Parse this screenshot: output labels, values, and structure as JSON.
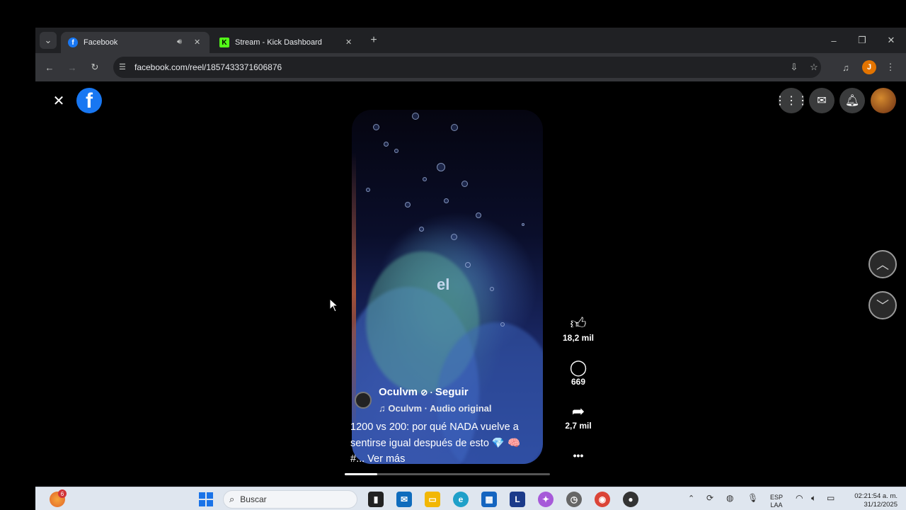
{
  "browser": {
    "tabs": [
      {
        "title": "Facebook",
        "favicon": "f"
      },
      {
        "title": "Stream - Kick Dashboard",
        "favicon": "K"
      }
    ],
    "new_tab": "+",
    "url": "facebook.com/reel/1857433371606876",
    "profile_initial": "J",
    "window_controls": {
      "minimize": "–",
      "restore": "❐",
      "close": "✕"
    }
  },
  "facebook": {
    "logo": "f",
    "close": "✕",
    "reel": {
      "overlay_word": "el",
      "author": "Oculvm",
      "follow": "Seguir",
      "audio": "♫ Oculvm · Audio original",
      "caption_line1": "1200 vs 200: por qué NADA vuelve a",
      "caption_line2": "sentirse igual después de esto 💎 🧠",
      "caption_line3": "#... Ver más"
    },
    "actions": {
      "likes": "18,2 mil",
      "comments": "669",
      "shares": "2,7 mil",
      "more": "•••"
    },
    "colors": {
      "brand": "#1877f2"
    }
  },
  "taskbar": {
    "search_placeholder": "Buscar",
    "notif_badge": "6",
    "lang1": "ESP",
    "lang2": "LAA",
    "time": "02:21:54 a. m.",
    "date": "31/12/2025"
  }
}
